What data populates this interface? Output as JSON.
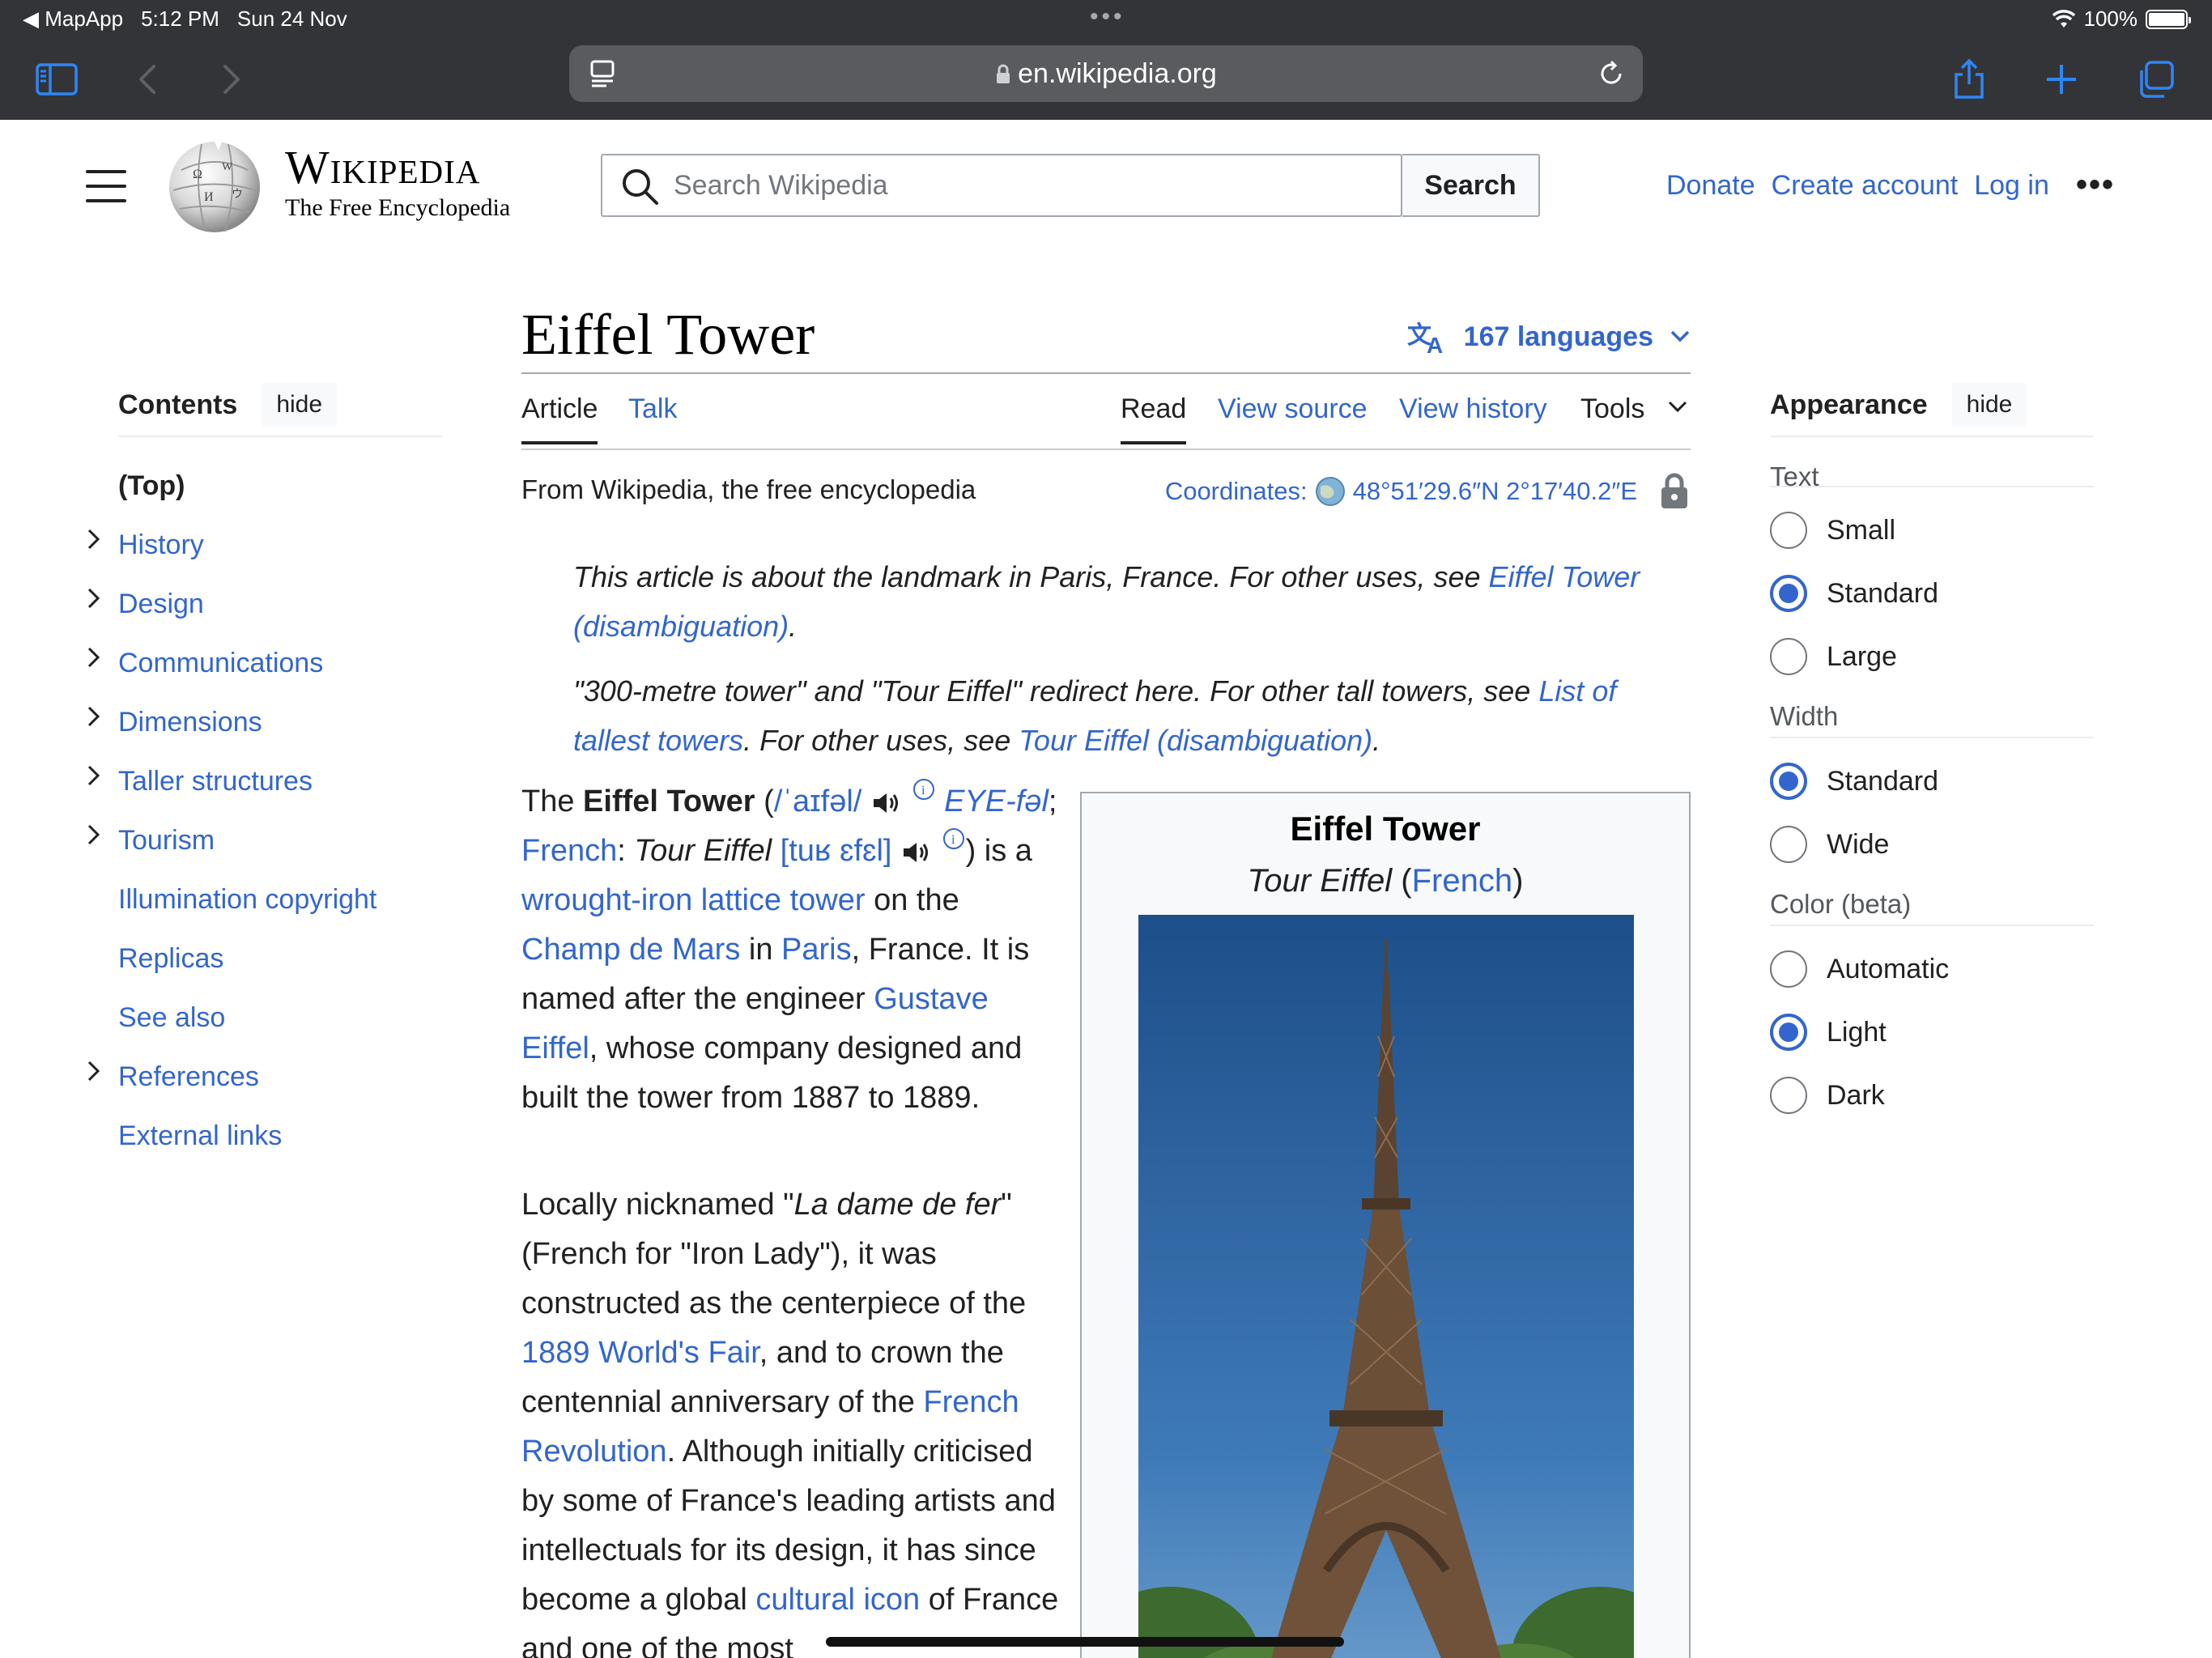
{
  "status_bar": {
    "back_app": "◀ MapApp",
    "time": "5:12 PM",
    "date": "Sun 24 Nov",
    "battery": "100%"
  },
  "browser": {
    "url": "en.wikipedia.org"
  },
  "header": {
    "wordmark": "Wikipedia",
    "tagline": "The Free Encyclopedia",
    "search_placeholder": "Search Wikipedia",
    "search_button": "Search",
    "links": [
      "Donate",
      "Create account",
      "Log in"
    ]
  },
  "toc": {
    "title": "Contents",
    "hide": "hide",
    "items": [
      {
        "label": "(Top)"
      },
      {
        "label": "History"
      },
      {
        "label": "Design"
      },
      {
        "label": "Communications"
      },
      {
        "label": "Dimensions"
      },
      {
        "label": "Taller structures"
      },
      {
        "label": "Tourism"
      },
      {
        "label": "Illumination copyright"
      },
      {
        "label": "Replicas"
      },
      {
        "label": "See also"
      },
      {
        "label": "References"
      },
      {
        "label": "External links"
      }
    ]
  },
  "article": {
    "title": "Eiffel Tower",
    "languages": "167 languages",
    "tabs": {
      "article": "Article",
      "talk": "Talk",
      "read": "Read",
      "view_source": "View source",
      "view_history": "View history",
      "tools": "Tools"
    },
    "from": "From Wikipedia, the free encyclopedia",
    "coordinates_label": "Coordinates",
    "coordinates_value": "48°51′29.6″N 2°17′40.2″E",
    "hatnote1": {
      "text": "This article is about the landmark in Paris, France. For other uses, see ",
      "link": "Eiffel Tower (disambiguation)"
    },
    "hatnote2": {
      "text": "\"300-metre tower\" and \"Tour Eiffel\" redirect here. For other tall towers, see ",
      "link1": "List of tallest towers",
      "mid": ". For other uses, see ",
      "link2": "Tour Eiffel (disambiguation)"
    },
    "para1": {
      "the": "The ",
      "bold": "Eiffel Tower",
      "ipa": "/ˈaɪfəl/",
      "respell": "EYE-fəl",
      "french": "French",
      "tour_eiffel": "Tour Eiffel",
      "ipa_fr": "[tuʁ ɛfɛl]",
      "is_a": "is a ",
      "lattice": "wrought-iron lattice tower",
      "on_the": " on the ",
      "champ": "Champ de Mars",
      "in": " in ",
      "paris": "Paris",
      "france": ", France. It is named after the engineer ",
      "gustave": "Gustave Eiffel",
      "rest": ", whose company designed and built the tower from 1887 to 1889."
    },
    "para2": {
      "a": "Locally nicknamed \"",
      "dame": "La dame de fer",
      "b": "\" (French for \"Iron Lady\"), it was constructed as the centerpiece of the ",
      "fair": "1889 World's Fair",
      "c": ", and to crown the centennial anniversary of the ",
      "revolution": "French Revolution",
      "d": ". Although initially criticised by some of France's leading artists and intellectuals for its design, it has since become a global ",
      "icon": "cultural icon",
      "e": " of France and one of the most"
    }
  },
  "infobox": {
    "title": "Eiffel Tower",
    "subtitle_italic": "Tour Eiffel",
    "subtitle_link": "French"
  },
  "appearance": {
    "title": "Appearance",
    "hide": "hide",
    "groups": [
      {
        "label": "Text",
        "options": [
          {
            "label": "Small",
            "selected": false
          },
          {
            "label": "Standard",
            "selected": true
          },
          {
            "label": "Large",
            "selected": false
          }
        ]
      },
      {
        "label": "Width",
        "options": [
          {
            "label": "Standard",
            "selected": true
          },
          {
            "label": "Wide",
            "selected": false
          }
        ]
      },
      {
        "label": "Color (beta)",
        "options": [
          {
            "label": "Automatic",
            "selected": false
          },
          {
            "label": "Light",
            "selected": true
          },
          {
            "label": "Dark",
            "selected": false
          }
        ]
      }
    ]
  },
  "colors": {
    "link": "#3366cc",
    "chrome": "#333438",
    "text": "#202122"
  }
}
